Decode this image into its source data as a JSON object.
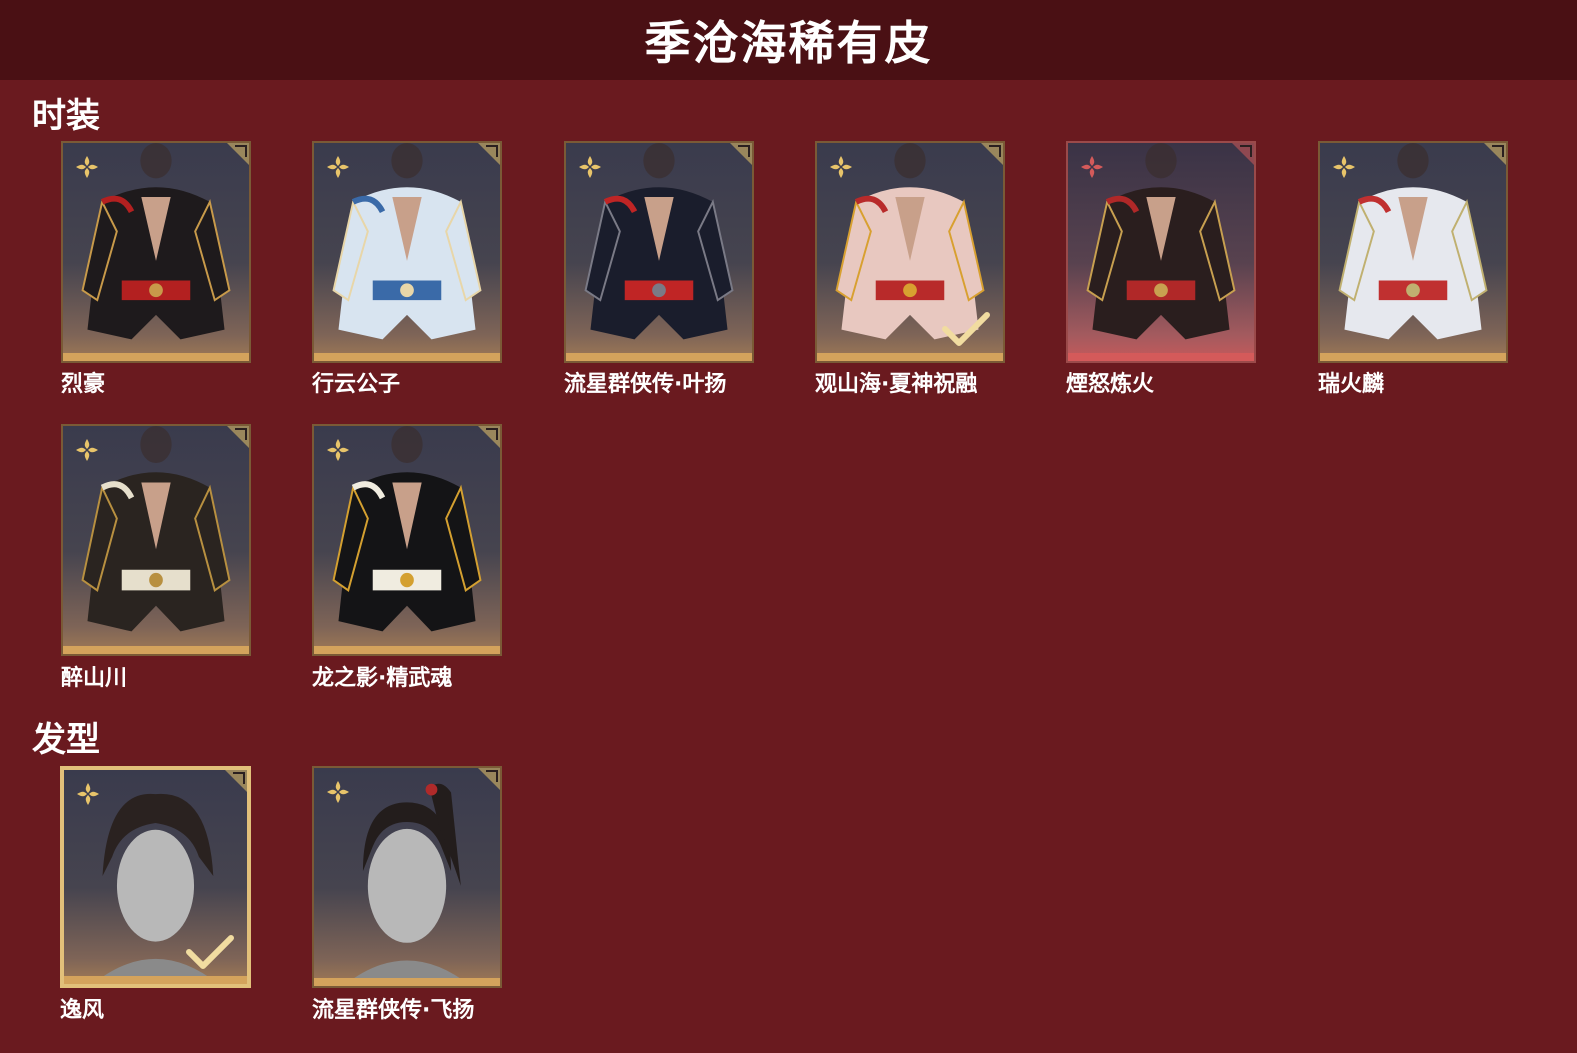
{
  "header": {
    "title": "季沧海稀有皮"
  },
  "sections": {
    "outfits": {
      "title": "时装",
      "items": [
        {
          "name": "烈豪",
          "rarity_icon": "gold-flower-icon",
          "selected": false
        },
        {
          "name": "行云公子",
          "rarity_icon": "gold-flower-icon",
          "selected": false
        },
        {
          "name": "流星群侠传·叶扬",
          "rarity_icon": "gold-flower-icon",
          "selected": false
        },
        {
          "name": "观山海·夏神祝融",
          "rarity_icon": "gold-flower-icon",
          "selected": false,
          "owned_check": true
        },
        {
          "name": "煙怒炼火",
          "rarity_icon": "red-flower-icon",
          "selected": false
        },
        {
          "name": "瑞火麟",
          "rarity_icon": "gold-flower-icon",
          "selected": false
        },
        {
          "name": "醉山川",
          "rarity_icon": "gold-flower-icon",
          "selected": false
        },
        {
          "name": "龙之影·精武魂",
          "rarity_icon": "gold-flower-icon",
          "selected": false
        }
      ]
    },
    "hairstyles": {
      "title": "发型",
      "items": [
        {
          "name": "逸风",
          "rarity_icon": "gold-flower-icon",
          "selected": true,
          "owned_check": true
        },
        {
          "name": "流星群侠传·飞扬",
          "rarity_icon": "gold-flower-icon",
          "selected": false
        }
      ]
    }
  },
  "colors": {
    "background": "#6a1a1f",
    "header": "#4a1014",
    "gold_rarity": "#e8c46a",
    "red_rarity": "#d45a5a"
  }
}
